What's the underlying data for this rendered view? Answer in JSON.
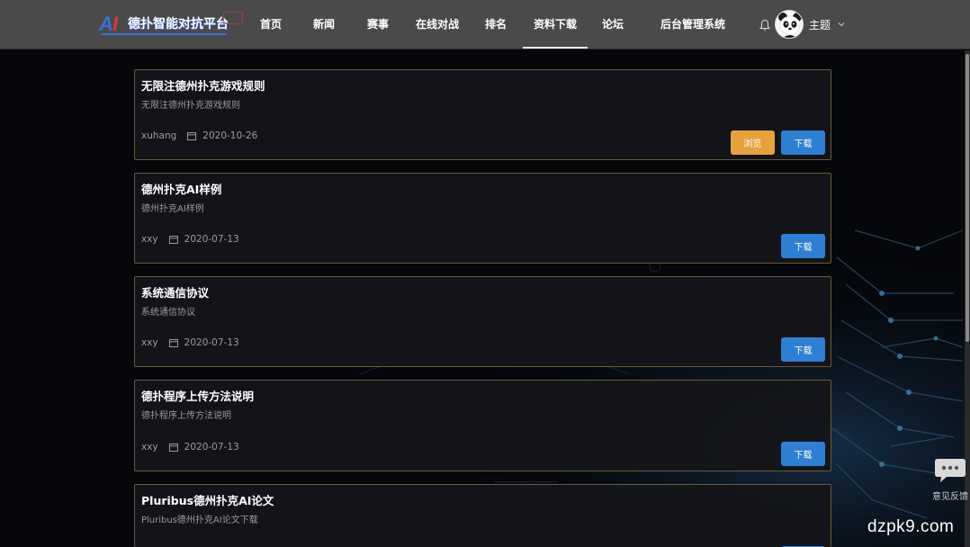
{
  "header": {
    "logo_text": "德扑智能对抗平台",
    "nav": [
      "首页",
      "新闻",
      "赛事",
      "在线对战",
      "排名",
      "资料下载",
      "论坛",
      "后台管理系统"
    ],
    "active_nav": "资料下载",
    "theme_label": "主题"
  },
  "documents": [
    {
      "title": "无限注德州扑克游戏规则",
      "desc": "无限注德州扑克游戏规则",
      "author": "xuhang",
      "date": "2020-10-26",
      "preview_label": "浏览",
      "download_label": "下载",
      "has_preview": true
    },
    {
      "title": "德州扑克AI样例",
      "desc": "德州扑克AI样例",
      "author": "xxy",
      "date": "2020-07-13",
      "download_label": "下载",
      "has_preview": false
    },
    {
      "title": "系统通信协议",
      "desc": "系统通信协议",
      "author": "xxy",
      "date": "2020-07-13",
      "download_label": "下载",
      "has_preview": false
    },
    {
      "title": "德扑程序上传方法说明",
      "desc": "德扑程序上传方法说明",
      "author": "xxy",
      "date": "2020-07-13",
      "download_label": "下载",
      "has_preview": false
    },
    {
      "title": "Pluribus德州扑克AI论文",
      "desc": "Pluribus德州扑克AI论文下载",
      "author": "",
      "date": "",
      "download_label": "下载",
      "has_preview": false
    }
  ],
  "feedback_label": "意见反馈",
  "watermark": "dzpk9.com",
  "colors": {
    "header_bg": "#4a4a4a",
    "card_border": "#6a5a3a",
    "download": "#2f7fd3",
    "preview": "#e6a23c"
  }
}
